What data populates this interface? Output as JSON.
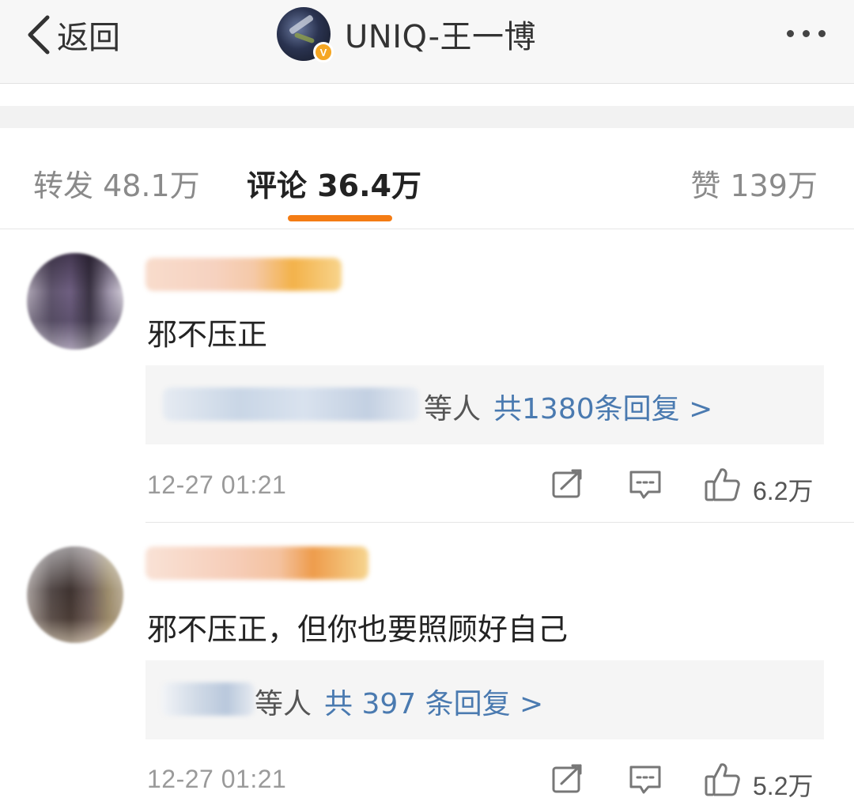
{
  "navbar": {
    "back_label": "返回",
    "title": "UNIQ-王一博",
    "verified_mark": "V"
  },
  "tabs": {
    "repost": "转发 48.1万",
    "comments": "评论 36.4万",
    "likes": "赞 139万",
    "active": "comments",
    "indicator_color": "#f47c14"
  },
  "comments": [
    {
      "text": "邪不压正",
      "reply_suffix": "等人",
      "reply_count": "共1380条回复 >",
      "time": "12-27 01:21",
      "likes": "6.2万"
    },
    {
      "text": "邪不压正，但你也要照顾好自己",
      "reply_suffix": "等人",
      "reply_count": "共 397 条回复 >",
      "time": "12-27 01:21",
      "likes": "5.2万"
    }
  ],
  "colors": {
    "link_blue": "#4a7ab0",
    "muted_text": "#9a9a9a",
    "accent_orange": "#f47c14"
  }
}
